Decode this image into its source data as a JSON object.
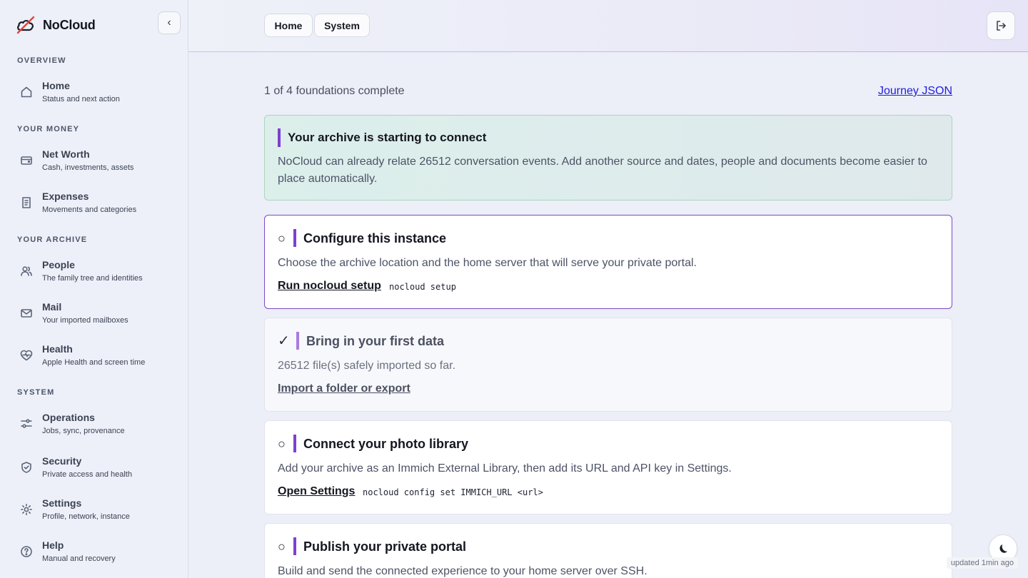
{
  "brand": {
    "name": "NoCloud"
  },
  "sidebar": {
    "collapse_glyph": "‹",
    "sections": {
      "overview": "OVERVIEW",
      "money": "YOUR MONEY",
      "archive": "YOUR ARCHIVE",
      "system": "SYSTEM"
    },
    "items": [
      {
        "title": "Home",
        "subtitle": "Status and next action",
        "icon": "home-icon"
      },
      {
        "title": "Net Worth",
        "subtitle": "Cash, investments, assets",
        "icon": "wallet-icon"
      },
      {
        "title": "Expenses",
        "subtitle": "Movements and categories",
        "icon": "receipt-icon"
      },
      {
        "title": "People",
        "subtitle": "The family tree and identities",
        "icon": "people-icon"
      },
      {
        "title": "Mail",
        "subtitle": "Your imported mailboxes",
        "icon": "mail-icon"
      },
      {
        "title": "Health",
        "subtitle": "Apple Health and screen time",
        "icon": "heart-pulse-icon"
      },
      {
        "title": "Operations",
        "subtitle": "Jobs, sync, provenance",
        "icon": "sliders-icon"
      },
      {
        "title": "Security",
        "subtitle": "Private access and health",
        "icon": "shield-icon"
      },
      {
        "title": "Settings",
        "subtitle": "Profile, network, instance",
        "icon": "gear-icon"
      },
      {
        "title": "Help",
        "subtitle": "Manual and recovery",
        "icon": "help-icon"
      }
    ]
  },
  "header": {
    "tabs": [
      {
        "label": "Home"
      },
      {
        "label": "System"
      }
    ],
    "logout_icon": "logout-icon"
  },
  "main": {
    "progress": "1 of 4 foundations complete",
    "journey_link": "Journey JSON",
    "banner": {
      "title": "Your archive is starting to connect",
      "body": "NoCloud can already relate 26512 conversation events. Add another source and dates, people and documents become easier to place automatically."
    },
    "steps": [
      {
        "status": "○",
        "title": "Configure this instance",
        "description": "Choose the archive location and the home server that will serve your private portal.",
        "action": "Run nocloud setup",
        "command": "nocloud setup"
      },
      {
        "status": "✓",
        "title": "Bring in your first data",
        "description": "26512 file(s) safely imported so far.",
        "action": "Import a folder or export",
        "command": ""
      },
      {
        "status": "○",
        "title": "Connect your photo library",
        "description": "Add your archive as an Immich External Library, then add its URL and API key in Settings.",
        "action": "Open Settings",
        "command": "nocloud config set IMMICH_URL <url>"
      },
      {
        "status": "○",
        "title": "Publish your private portal",
        "description": "Build and send the connected experience to your home server over SSH.",
        "action": "",
        "command": ""
      }
    ]
  },
  "footer": {
    "updated": "updated 1min ago",
    "theme_icon": "moon-icon"
  }
}
